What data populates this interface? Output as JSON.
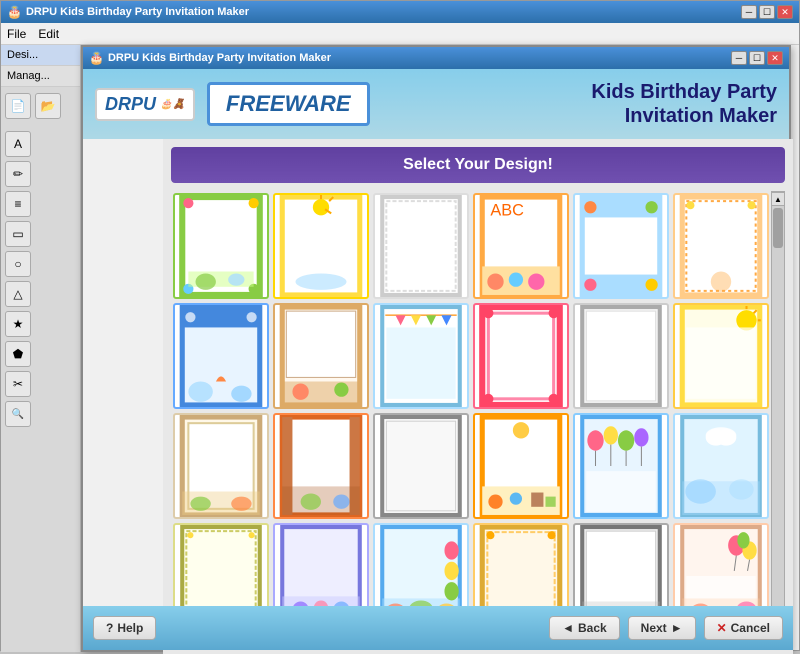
{
  "outerWindow": {
    "title": "DRPU Kids Birthday Party Invitation Maker",
    "controls": [
      "minimize",
      "maximize",
      "close"
    ]
  },
  "innerWindow": {
    "title": "DRPU Kids Birthday Party Invitation Maker",
    "controls": [
      "minimize",
      "maximize",
      "close"
    ]
  },
  "header": {
    "logo": "DRPU",
    "freeware": "FREEWARE",
    "appTitle": "Kids Birthday Party\nInvitation Maker"
  },
  "menubar": {
    "items": [
      "File",
      "Edit"
    ]
  },
  "designSection": {
    "heading": "Select Your Design!"
  },
  "tabs": {
    "design": "Desi...",
    "manage": "Manag..."
  },
  "cards": [
    {
      "id": 1,
      "colors": [
        "#88cc44",
        "#ffffff",
        "#66aa22"
      ],
      "style": "floral-green"
    },
    {
      "id": 2,
      "colors": [
        "#ffdd44",
        "#ffffff",
        "#ffaa00"
      ],
      "style": "sunny"
    },
    {
      "id": 3,
      "colors": [
        "#dddddd",
        "#ffffff",
        "#bbbbbb"
      ],
      "style": "plain-light"
    },
    {
      "id": 4,
      "colors": [
        "#ffaa44",
        "#ffffff",
        "#ff8822"
      ],
      "style": "warm"
    },
    {
      "id": 5,
      "colors": [
        "#aaddff",
        "#ffffff",
        "#77bbee"
      ],
      "style": "blue-light"
    },
    {
      "id": 6,
      "colors": [
        "#ffcc88",
        "#ffffff",
        "#ffaa44"
      ],
      "style": "pastel-orange"
    },
    {
      "id": 7,
      "colors": [
        "#66aaff",
        "#ffffff",
        "#4488dd"
      ],
      "style": "blue-bold"
    },
    {
      "id": 8,
      "colors": [
        "#ddbb88",
        "#f5e5cc",
        "#cc9966"
      ],
      "style": "warm-beige"
    },
    {
      "id": 9,
      "colors": [
        "#aaddff",
        "#e0f5ff",
        "#77bbdd"
      ],
      "style": "sky-blue"
    },
    {
      "id": 10,
      "colors": [
        "#ff6688",
        "#ffffff",
        "#dd4466"
      ],
      "style": "pink-bold"
    },
    {
      "id": 11,
      "colors": [
        "#cccccc",
        "#f5f5f5",
        "#aaaaaa"
      ],
      "style": "gray-light"
    },
    {
      "id": 12,
      "colors": [
        "#ffdd44",
        "#fffde0",
        "#ddaa00"
      ],
      "style": "yellow-sunny"
    },
    {
      "id": 13,
      "colors": [
        "#ddccaa",
        "#f5f0e0",
        "#bbaa88"
      ],
      "style": "cream"
    },
    {
      "id": 14,
      "colors": [
        "#ff8844",
        "#fff8f0",
        "#cc6622"
      ],
      "style": "orange-warm"
    },
    {
      "id": 15,
      "colors": [
        "#aaaaaa",
        "#f0f0f0",
        "#888888"
      ],
      "style": "plain-gray"
    },
    {
      "id": 16,
      "colors": [
        "#ff9900",
        "#fff5e0",
        "#dd7700"
      ],
      "style": "orange"
    },
    {
      "id": 17,
      "colors": [
        "#88ccff",
        "#e8f5ff",
        "#55aaee"
      ],
      "style": "light-blue"
    },
    {
      "id": 18,
      "colors": [
        "#aaddff",
        "#e8f8ff",
        "#77bbdd"
      ],
      "style": "sky"
    },
    {
      "id": 19,
      "colors": [
        "#dddd88",
        "#ffffee",
        "#aaaa44"
      ],
      "style": "yellow-light"
    },
    {
      "id": 20,
      "colors": [
        "#aaaaff",
        "#eeeeFF",
        "#7777dd"
      ],
      "style": "lavender"
    },
    {
      "id": 21,
      "colors": [
        "#aaddff",
        "#e8f8ff",
        "#55aaee"
      ],
      "style": "blue-sky"
    },
    {
      "id": 22,
      "colors": [
        "#ffcc66",
        "#fff8e8",
        "#ddaa33"
      ],
      "style": "golden"
    },
    {
      "id": 23,
      "colors": [
        "#aaaaaa",
        "#eeeeee",
        "#777777"
      ],
      "style": "neutral"
    },
    {
      "id": 24,
      "colors": [
        "#ffccaa",
        "#fff5ee",
        "#ddaa88"
      ],
      "style": "peach"
    }
  ],
  "bottomBar": {
    "helpLabel": "Help",
    "backLabel": "Back",
    "nextLabel": "Next",
    "cancelLabel": "Cancel"
  },
  "sidebarTools": [
    "A",
    "✏",
    "☰",
    "◻",
    "○",
    "△",
    "★",
    "⬟",
    "✂",
    "🔍"
  ],
  "icons": {
    "question": "?",
    "arrowLeft": "◄",
    "arrowRight": "►",
    "close": "✕",
    "minimize": "─",
    "maximize": "☐",
    "windowClose": "✕",
    "folderOpen": "📂",
    "newFile": "📄"
  }
}
